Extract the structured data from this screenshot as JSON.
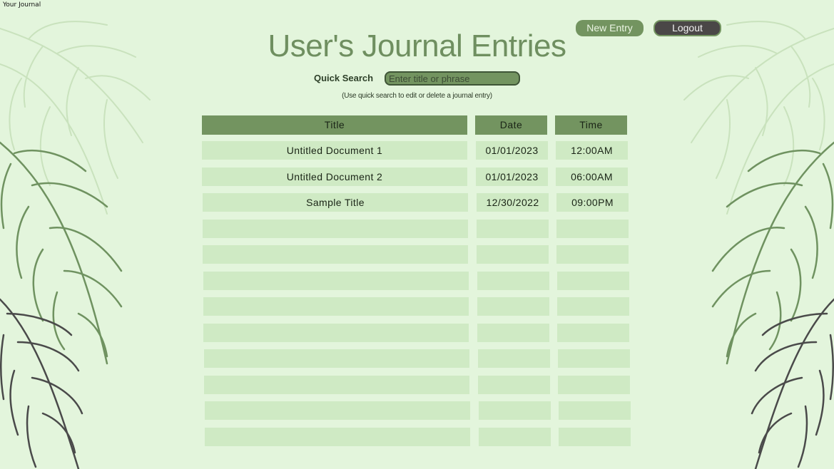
{
  "window": {
    "title": "Your Journal"
  },
  "header": {
    "title": "User's Journal Entries",
    "new_entry_label": "New Entry",
    "logout_label": "Logout"
  },
  "search": {
    "label": "Quick Search",
    "placeholder": "Enter title or phrase",
    "value": "",
    "hint": "(Use quick search to edit or delete a journal entry)"
  },
  "table": {
    "columns": [
      "Title",
      "Date",
      "Time"
    ],
    "rows": [
      [
        "Untitled Document 1",
        "01/01/2023",
        "12:00AM"
      ],
      [
        "Untitled Document 2",
        "01/01/2023",
        "06:00AM"
      ],
      [
        "Sample Title",
        "12/30/2022",
        "09:00PM"
      ],
      [
        "",
        "",
        ""
      ],
      [
        "",
        "",
        ""
      ],
      [
        "",
        "",
        ""
      ],
      [
        "",
        "",
        ""
      ],
      [
        "",
        "",
        ""
      ],
      [
        "",
        "",
        ""
      ],
      [
        "",
        "",
        ""
      ],
      [
        "",
        "",
        ""
      ],
      [
        "",
        "",
        ""
      ]
    ]
  },
  "colors": {
    "background": "#e3f5dc",
    "accent_green": "#739460",
    "cell_green": "#cfeac4",
    "title_green": "#6f8f60",
    "logout_dark": "#4a4747"
  },
  "decorations": [
    "fern-leaves-left",
    "fern-leaves-right"
  ]
}
